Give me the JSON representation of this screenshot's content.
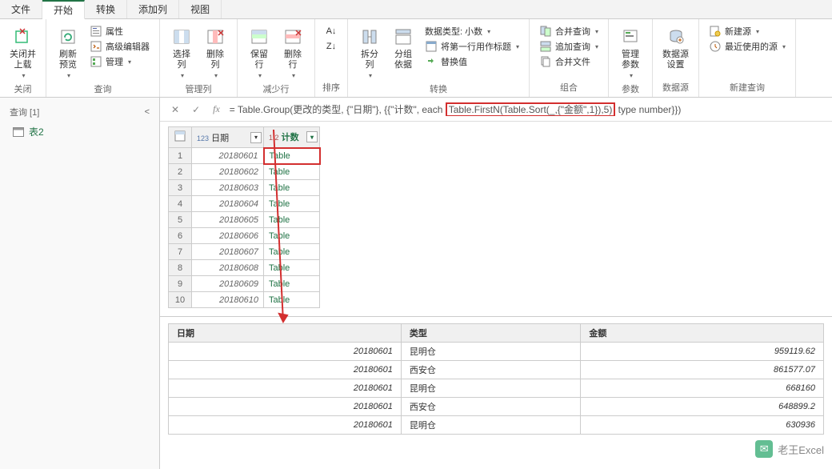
{
  "tabs": [
    "文件",
    "开始",
    "转换",
    "添加列",
    "视图"
  ],
  "active_tab": 1,
  "ribbon": {
    "close_group": {
      "close_label": "关闭并\n上载",
      "group": "关闭"
    },
    "query_group": {
      "refresh_label": "刷新\n预览",
      "props": "属性",
      "adv_editor": "高级编辑器",
      "manage": "管理",
      "group": "查询"
    },
    "cols_group": {
      "choose_label": "选择\n列",
      "remove_label": "删除\n列",
      "group": "管理列"
    },
    "rows_group": {
      "keep_label": "保留\n行",
      "remove_label": "删除\n行",
      "group": "减少行"
    },
    "sort_group": {
      "group": "排序"
    },
    "transform_group": {
      "split_label": "拆分\n列",
      "groupby_label": "分组\n依据",
      "datatype": "数据类型: 小数",
      "first_row": "将第一行用作标题",
      "replace": "替换值",
      "group": "转换"
    },
    "combine_group": {
      "merge": "合并查询",
      "append": "追加查询",
      "combine_files": "合并文件",
      "group": "组合"
    },
    "params_group": {
      "label": "管理\n参数",
      "group": "参数"
    },
    "source_group": {
      "label": "数据源\n设置",
      "group": "数据源"
    },
    "new_group": {
      "new_source": "新建源",
      "recent": "最近使用的源",
      "group": "新建查询"
    }
  },
  "sidebar": {
    "header": "查询 [1]",
    "items": [
      "表2"
    ]
  },
  "formula": {
    "prefix": "= Table.Group(更改的类型, {\"日期\"}, {{\"计数\", each ",
    "highlight": "Table.FirstN(Table.Sort(_,{\"金额\",1}),5)",
    "suffix": "  type number}})"
  },
  "grid": {
    "columns": [
      {
        "label": "日期",
        "type_icon": "123"
      },
      {
        "label": "计数",
        "type_icon": "1.2",
        "green": true
      }
    ],
    "rows": [
      {
        "date": "20180601",
        "count": "Table",
        "first": true
      },
      {
        "date": "20180602",
        "count": "Table"
      },
      {
        "date": "20180603",
        "count": "Table"
      },
      {
        "date": "20180604",
        "count": "Table"
      },
      {
        "date": "20180605",
        "count": "Table"
      },
      {
        "date": "20180606",
        "count": "Table"
      },
      {
        "date": "20180607",
        "count": "Table"
      },
      {
        "date": "20180608",
        "count": "Table"
      },
      {
        "date": "20180609",
        "count": "Table"
      },
      {
        "date": "20180610",
        "count": "Table"
      }
    ]
  },
  "preview": {
    "columns": [
      "日期",
      "类型",
      "金额"
    ],
    "rows": [
      [
        "20180601",
        "昆明仓",
        "959119.62"
      ],
      [
        "20180601",
        "西安仓",
        "861577.07"
      ],
      [
        "20180601",
        "昆明仓",
        "668160"
      ],
      [
        "20180601",
        "西安仓",
        "648899.2"
      ],
      [
        "20180601",
        "昆明仓",
        "630936"
      ]
    ]
  },
  "watermark": "老王Excel"
}
